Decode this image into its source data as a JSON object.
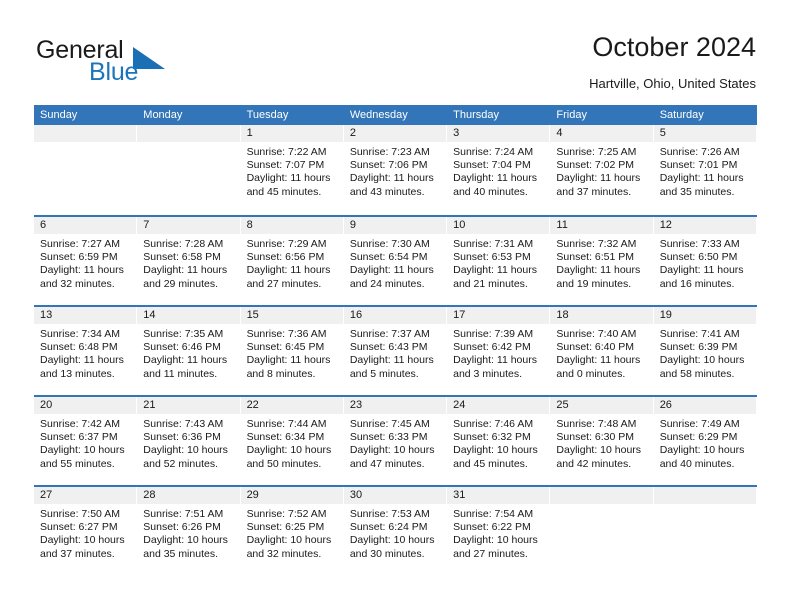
{
  "brand": {
    "word_one": "General",
    "word_two": "Blue",
    "accent_color": "#1b75bb"
  },
  "header": {
    "title": "October 2024",
    "location": "Hartville, Ohio, United States"
  },
  "theme": {
    "header_bar": "#3275b8",
    "daynum_band": "#f0f0f0",
    "text": "#1a1a1a"
  },
  "weekdays": [
    "Sunday",
    "Monday",
    "Tuesday",
    "Wednesday",
    "Thursday",
    "Friday",
    "Saturday"
  ],
  "weeks": [
    [
      {
        "day": "",
        "sunrise": "",
        "sunset": "",
        "daylight_1": "",
        "daylight_2": ""
      },
      {
        "day": "",
        "sunrise": "",
        "sunset": "",
        "daylight_1": "",
        "daylight_2": ""
      },
      {
        "day": "1",
        "sunrise": "Sunrise: 7:22 AM",
        "sunset": "Sunset: 7:07 PM",
        "daylight_1": "Daylight: 11 hours",
        "daylight_2": "and 45 minutes."
      },
      {
        "day": "2",
        "sunrise": "Sunrise: 7:23 AM",
        "sunset": "Sunset: 7:06 PM",
        "daylight_1": "Daylight: 11 hours",
        "daylight_2": "and 43 minutes."
      },
      {
        "day": "3",
        "sunrise": "Sunrise: 7:24 AM",
        "sunset": "Sunset: 7:04 PM",
        "daylight_1": "Daylight: 11 hours",
        "daylight_2": "and 40 minutes."
      },
      {
        "day": "4",
        "sunrise": "Sunrise: 7:25 AM",
        "sunset": "Sunset: 7:02 PM",
        "daylight_1": "Daylight: 11 hours",
        "daylight_2": "and 37 minutes."
      },
      {
        "day": "5",
        "sunrise": "Sunrise: 7:26 AM",
        "sunset": "Sunset: 7:01 PM",
        "daylight_1": "Daylight: 11 hours",
        "daylight_2": "and 35 minutes."
      }
    ],
    [
      {
        "day": "6",
        "sunrise": "Sunrise: 7:27 AM",
        "sunset": "Sunset: 6:59 PM",
        "daylight_1": "Daylight: 11 hours",
        "daylight_2": "and 32 minutes."
      },
      {
        "day": "7",
        "sunrise": "Sunrise: 7:28 AM",
        "sunset": "Sunset: 6:58 PM",
        "daylight_1": "Daylight: 11 hours",
        "daylight_2": "and 29 minutes."
      },
      {
        "day": "8",
        "sunrise": "Sunrise: 7:29 AM",
        "sunset": "Sunset: 6:56 PM",
        "daylight_1": "Daylight: 11 hours",
        "daylight_2": "and 27 minutes."
      },
      {
        "day": "9",
        "sunrise": "Sunrise: 7:30 AM",
        "sunset": "Sunset: 6:54 PM",
        "daylight_1": "Daylight: 11 hours",
        "daylight_2": "and 24 minutes."
      },
      {
        "day": "10",
        "sunrise": "Sunrise: 7:31 AM",
        "sunset": "Sunset: 6:53 PM",
        "daylight_1": "Daylight: 11 hours",
        "daylight_2": "and 21 minutes."
      },
      {
        "day": "11",
        "sunrise": "Sunrise: 7:32 AM",
        "sunset": "Sunset: 6:51 PM",
        "daylight_1": "Daylight: 11 hours",
        "daylight_2": "and 19 minutes."
      },
      {
        "day": "12",
        "sunrise": "Sunrise: 7:33 AM",
        "sunset": "Sunset: 6:50 PM",
        "daylight_1": "Daylight: 11 hours",
        "daylight_2": "and 16 minutes."
      }
    ],
    [
      {
        "day": "13",
        "sunrise": "Sunrise: 7:34 AM",
        "sunset": "Sunset: 6:48 PM",
        "daylight_1": "Daylight: 11 hours",
        "daylight_2": "and 13 minutes."
      },
      {
        "day": "14",
        "sunrise": "Sunrise: 7:35 AM",
        "sunset": "Sunset: 6:46 PM",
        "daylight_1": "Daylight: 11 hours",
        "daylight_2": "and 11 minutes."
      },
      {
        "day": "15",
        "sunrise": "Sunrise: 7:36 AM",
        "sunset": "Sunset: 6:45 PM",
        "daylight_1": "Daylight: 11 hours",
        "daylight_2": "and 8 minutes."
      },
      {
        "day": "16",
        "sunrise": "Sunrise: 7:37 AM",
        "sunset": "Sunset: 6:43 PM",
        "daylight_1": "Daylight: 11 hours",
        "daylight_2": "and 5 minutes."
      },
      {
        "day": "17",
        "sunrise": "Sunrise: 7:39 AM",
        "sunset": "Sunset: 6:42 PM",
        "daylight_1": "Daylight: 11 hours",
        "daylight_2": "and 3 minutes."
      },
      {
        "day": "18",
        "sunrise": "Sunrise: 7:40 AM",
        "sunset": "Sunset: 6:40 PM",
        "daylight_1": "Daylight: 11 hours",
        "daylight_2": "and 0 minutes."
      },
      {
        "day": "19",
        "sunrise": "Sunrise: 7:41 AM",
        "sunset": "Sunset: 6:39 PM",
        "daylight_1": "Daylight: 10 hours",
        "daylight_2": "and 58 minutes."
      }
    ],
    [
      {
        "day": "20",
        "sunrise": "Sunrise: 7:42 AM",
        "sunset": "Sunset: 6:37 PM",
        "daylight_1": "Daylight: 10 hours",
        "daylight_2": "and 55 minutes."
      },
      {
        "day": "21",
        "sunrise": "Sunrise: 7:43 AM",
        "sunset": "Sunset: 6:36 PM",
        "daylight_1": "Daylight: 10 hours",
        "daylight_2": "and 52 minutes."
      },
      {
        "day": "22",
        "sunrise": "Sunrise: 7:44 AM",
        "sunset": "Sunset: 6:34 PM",
        "daylight_1": "Daylight: 10 hours",
        "daylight_2": "and 50 minutes."
      },
      {
        "day": "23",
        "sunrise": "Sunrise: 7:45 AM",
        "sunset": "Sunset: 6:33 PM",
        "daylight_1": "Daylight: 10 hours",
        "daylight_2": "and 47 minutes."
      },
      {
        "day": "24",
        "sunrise": "Sunrise: 7:46 AM",
        "sunset": "Sunset: 6:32 PM",
        "daylight_1": "Daylight: 10 hours",
        "daylight_2": "and 45 minutes."
      },
      {
        "day": "25",
        "sunrise": "Sunrise: 7:48 AM",
        "sunset": "Sunset: 6:30 PM",
        "daylight_1": "Daylight: 10 hours",
        "daylight_2": "and 42 minutes."
      },
      {
        "day": "26",
        "sunrise": "Sunrise: 7:49 AM",
        "sunset": "Sunset: 6:29 PM",
        "daylight_1": "Daylight: 10 hours",
        "daylight_2": "and 40 minutes."
      }
    ],
    [
      {
        "day": "27",
        "sunrise": "Sunrise: 7:50 AM",
        "sunset": "Sunset: 6:27 PM",
        "daylight_1": "Daylight: 10 hours",
        "daylight_2": "and 37 minutes."
      },
      {
        "day": "28",
        "sunrise": "Sunrise: 7:51 AM",
        "sunset": "Sunset: 6:26 PM",
        "daylight_1": "Daylight: 10 hours",
        "daylight_2": "and 35 minutes."
      },
      {
        "day": "29",
        "sunrise": "Sunrise: 7:52 AM",
        "sunset": "Sunset: 6:25 PM",
        "daylight_1": "Daylight: 10 hours",
        "daylight_2": "and 32 minutes."
      },
      {
        "day": "30",
        "sunrise": "Sunrise: 7:53 AM",
        "sunset": "Sunset: 6:24 PM",
        "daylight_1": "Daylight: 10 hours",
        "daylight_2": "and 30 minutes."
      },
      {
        "day": "31",
        "sunrise": "Sunrise: 7:54 AM",
        "sunset": "Sunset: 6:22 PM",
        "daylight_1": "Daylight: 10 hours",
        "daylight_2": "and 27 minutes."
      },
      {
        "day": "",
        "sunrise": "",
        "sunset": "",
        "daylight_1": "",
        "daylight_2": ""
      },
      {
        "day": "",
        "sunrise": "",
        "sunset": "",
        "daylight_1": "",
        "daylight_2": ""
      }
    ]
  ]
}
